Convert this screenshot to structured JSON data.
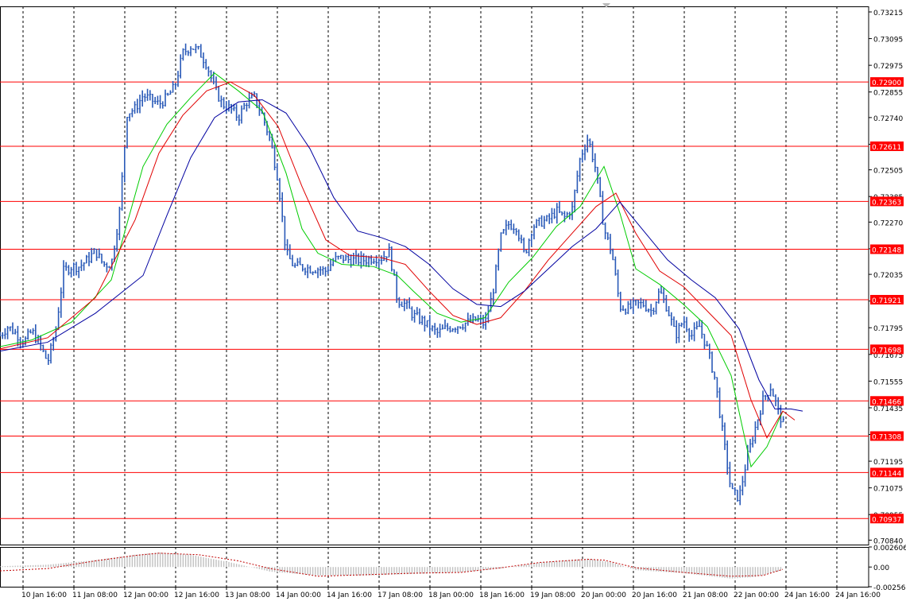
{
  "chart_data": [
    {
      "type": "candlestick",
      "y_ticks": [
        "0.73215",
        "0.73095",
        "0.72975",
        "0.72855",
        "0.72740",
        "0.72620",
        "0.72505",
        "0.72385",
        "0.72270",
        "0.72150",
        "0.72035",
        "0.71915",
        "0.71795",
        "0.71675",
        "0.71555",
        "0.71435",
        "0.71315",
        "0.71195",
        "0.71075",
        "0.70955",
        "0.70840"
      ],
      "ylim": [
        0.7082,
        0.7324
      ],
      "x_ticks": [
        "10 Jan 16:00",
        "11 Jan 08:00",
        "12 Jan 00:00",
        "12 Jan 16:00",
        "13 Jan 08:00",
        "14 Jan 00:00",
        "14 Jan 16:00",
        "17 Jan 08:00",
        "18 Jan 00:00",
        "18 Jan 16:00",
        "19 Jan 08:00",
        "20 Jan 00:00",
        "20 Jan 16:00",
        "21 Jan 08:00",
        "22 Jan 00:00",
        "24 Jan 16:00",
        "24 Jan 16:00"
      ],
      "price_levels": [
        {
          "value": 0.729,
          "label": "0.72900"
        },
        {
          "value": 0.72611,
          "label": "0.72611"
        },
        {
          "value": 0.72363,
          "label": "0.72363"
        },
        {
          "value": 0.72148,
          "label": "0.72148"
        },
        {
          "value": 0.71921,
          "label": "0.71921"
        },
        {
          "value": 0.71698,
          "label": "0.71698"
        },
        {
          "value": 0.71466,
          "label": "0.71466"
        },
        {
          "value": 0.71308,
          "label": "0.71308"
        },
        {
          "value": 0.71144,
          "label": "0.71144"
        },
        {
          "value": 0.70937,
          "label": "0.70937"
        }
      ],
      "price_path": [
        [
          0,
          0.7176
        ],
        [
          10,
          0.718
        ],
        [
          20,
          0.7177
        ],
        [
          30,
          0.7173
        ],
        [
          40,
          0.7178
        ],
        [
          50,
          0.7172
        ],
        [
          60,
          0.7164
        ],
        [
          70,
          0.7178
        ],
        [
          80,
          0.7205
        ],
        [
          90,
          0.7207
        ],
        [
          100,
          0.7207
        ],
        [
          110,
          0.721
        ],
        [
          120,
          0.7214
        ],
        [
          130,
          0.7208
        ],
        [
          140,
          0.7208
        ],
        [
          150,
          0.723
        ],
        [
          160,
          0.7276
        ],
        [
          170,
          0.7278
        ],
        [
          180,
          0.7284
        ],
        [
          190,
          0.7282
        ],
        [
          200,
          0.728
        ],
        [
          210,
          0.7283
        ],
        [
          220,
          0.7288
        ],
        [
          230,
          0.7303
        ],
        [
          240,
          0.7306
        ],
        [
          250,
          0.7304
        ],
        [
          260,
          0.7298
        ],
        [
          270,
          0.7287
        ],
        [
          280,
          0.728
        ],
        [
          290,
          0.7278
        ],
        [
          300,
          0.7274
        ],
        [
          310,
          0.7281
        ],
        [
          320,
          0.7283
        ],
        [
          330,
          0.7275
        ],
        [
          340,
          0.7264
        ],
        [
          350,
          0.7246
        ],
        [
          360,
          0.7213
        ],
        [
          370,
          0.7207
        ],
        [
          380,
          0.7207
        ],
        [
          390,
          0.7206
        ],
        [
          400,
          0.7206
        ],
        [
          410,
          0.7205
        ],
        [
          420,
          0.721
        ],
        [
          430,
          0.7211
        ],
        [
          440,
          0.721
        ],
        [
          450,
          0.721
        ],
        [
          460,
          0.721
        ],
        [
          470,
          0.7211
        ],
        [
          480,
          0.7211
        ],
        [
          490,
          0.7214
        ],
        [
          500,
          0.7192
        ],
        [
          510,
          0.719
        ],
        [
          520,
          0.7185
        ],
        [
          530,
          0.7183
        ],
        [
          540,
          0.718
        ],
        [
          550,
          0.7177
        ],
        [
          560,
          0.7179
        ],
        [
          570,
          0.718
        ],
        [
          580,
          0.7181
        ],
        [
          590,
          0.7182
        ],
        [
          600,
          0.7183
        ],
        [
          610,
          0.7181
        ],
        [
          620,
          0.7195
        ],
        [
          630,
          0.722
        ],
        [
          640,
          0.7226
        ],
        [
          650,
          0.7225
        ],
        [
          660,
          0.7212
        ],
        [
          670,
          0.7225
        ],
        [
          680,
          0.7227
        ],
        [
          690,
          0.7228
        ],
        [
          700,
          0.7232
        ],
        [
          710,
          0.7229
        ],
        [
          720,
          0.7233
        ],
        [
          730,
          0.7256
        ],
        [
          740,
          0.7265
        ],
        [
          750,
          0.725
        ],
        [
          760,
          0.7224
        ],
        [
          770,
          0.7213
        ],
        [
          780,
          0.7189
        ],
        [
          790,
          0.7188
        ],
        [
          800,
          0.719
        ],
        [
          810,
          0.719
        ],
        [
          820,
          0.7187
        ],
        [
          830,
          0.7196
        ],
        [
          840,
          0.7188
        ],
        [
          850,
          0.7176
        ],
        [
          860,
          0.7183
        ],
        [
          870,
          0.7176
        ],
        [
          880,
          0.718
        ],
        [
          890,
          0.717
        ],
        [
          900,
          0.7156
        ],
        [
          910,
          0.713
        ],
        [
          920,
          0.7106
        ],
        [
          930,
          0.7103
        ],
        [
          940,
          0.7121
        ],
        [
          950,
          0.7134
        ],
        [
          960,
          0.7147
        ],
        [
          970,
          0.7153
        ],
        [
          980,
          0.7141
        ],
        [
          987,
          0.7135
        ]
      ],
      "moving_averages": [
        {
          "color": "#00cc00",
          "points": [
            [
              0,
              0.7171
            ],
            [
              40,
              0.7174
            ],
            [
              90,
              0.7182
            ],
            [
              140,
              0.7201
            ],
            [
              180,
              0.7252
            ],
            [
              210,
              0.7271
            ],
            [
              240,
              0.7283
            ],
            [
              270,
              0.7294
            ],
            [
              300,
              0.7286
            ],
            [
              330,
              0.7277
            ],
            [
              360,
              0.7249
            ],
            [
              380,
              0.7224
            ],
            [
              400,
              0.7213
            ],
            [
              430,
              0.7208
            ],
            [
              470,
              0.7207
            ],
            [
              500,
              0.7203
            ],
            [
              520,
              0.7196
            ],
            [
              550,
              0.7186
            ],
            [
              580,
              0.7182
            ],
            [
              610,
              0.7184
            ],
            [
              640,
              0.72
            ],
            [
              670,
              0.7211
            ],
            [
              700,
              0.7225
            ],
            [
              730,
              0.7234
            ],
            [
              760,
              0.7252
            ],
            [
              780,
              0.7231
            ],
            [
              800,
              0.7206
            ],
            [
              830,
              0.7199
            ],
            [
              860,
              0.719
            ],
            [
              890,
              0.718
            ],
            [
              920,
              0.7158
            ],
            [
              945,
              0.7117
            ],
            [
              965,
              0.7126
            ],
            [
              985,
              0.7142
            ]
          ]
        },
        {
          "color": "#e00000",
          "points": [
            [
              0,
              0.717
            ],
            [
              60,
              0.7175
            ],
            [
              120,
              0.7193
            ],
            [
              170,
              0.7228
            ],
            [
              200,
              0.7258
            ],
            [
              230,
              0.7275
            ],
            [
              260,
              0.7286
            ],
            [
              290,
              0.729
            ],
            [
              320,
              0.7284
            ],
            [
              350,
              0.727
            ],
            [
              380,
              0.7243
            ],
            [
              410,
              0.7219
            ],
            [
              440,
              0.7212
            ],
            [
              480,
              0.7211
            ],
            [
              510,
              0.7208
            ],
            [
              540,
              0.7196
            ],
            [
              570,
              0.7185
            ],
            [
              600,
              0.7181
            ],
            [
              630,
              0.7184
            ],
            [
              660,
              0.7196
            ],
            [
              690,
              0.721
            ],
            [
              720,
              0.7222
            ],
            [
              750,
              0.7234
            ],
            [
              775,
              0.724
            ],
            [
              800,
              0.7222
            ],
            [
              830,
              0.7205
            ],
            [
              860,
              0.7198
            ],
            [
              890,
              0.7187
            ],
            [
              920,
              0.7176
            ],
            [
              945,
              0.7147
            ],
            [
              965,
              0.713
            ],
            [
              985,
              0.7142
            ],
            [
              1000,
              0.7138
            ]
          ]
        },
        {
          "color": "#0000a0",
          "points": [
            [
              0,
              0.7169
            ],
            [
              60,
              0.7173
            ],
            [
              120,
              0.7186
            ],
            [
              180,
              0.7203
            ],
            [
              210,
              0.723
            ],
            [
              240,
              0.7256
            ],
            [
              270,
              0.7274
            ],
            [
              300,
              0.7281
            ],
            [
              330,
              0.7282
            ],
            [
              360,
              0.7276
            ],
            [
              390,
              0.726
            ],
            [
              420,
              0.7238
            ],
            [
              450,
              0.7223
            ],
            [
              480,
              0.722
            ],
            [
              510,
              0.7216
            ],
            [
              540,
              0.7208
            ],
            [
              570,
              0.7197
            ],
            [
              600,
              0.719
            ],
            [
              630,
              0.7189
            ],
            [
              660,
              0.7196
            ],
            [
              690,
              0.7206
            ],
            [
              720,
              0.7216
            ],
            [
              750,
              0.7224
            ],
            [
              780,
              0.7236
            ],
            [
              810,
              0.7223
            ],
            [
              840,
              0.721
            ],
            [
              870,
              0.7201
            ],
            [
              900,
              0.7193
            ],
            [
              930,
              0.7179
            ],
            [
              955,
              0.7156
            ],
            [
              975,
              0.7143
            ],
            [
              995,
              0.7143
            ],
            [
              1010,
              0.7142
            ]
          ]
        }
      ]
    },
    {
      "type": "histogram",
      "y_ticks": [
        "0.002606",
        "0.00",
        "-0.00256"
      ],
      "ylim": [
        -0.00256,
        0.002606
      ],
      "signal_color": "#c00000",
      "histogram_color": "#c0c0c0",
      "signal_path": [
        [
          0,
          -0.0005
        ],
        [
          60,
          -0.0002
        ],
        [
          120,
          0.0008
        ],
        [
          170,
          0.0015
        ],
        [
          200,
          0.0018
        ],
        [
          250,
          0.0016
        ],
        [
          300,
          0.0008
        ],
        [
          340,
          -0.0002
        ],
        [
          400,
          -0.0012
        ],
        [
          460,
          -0.001
        ],
        [
          520,
          -0.0008
        ],
        [
          580,
          -0.0007
        ],
        [
          630,
          -0.0001
        ],
        [
          680,
          0.0006
        ],
        [
          740,
          0.001
        ],
        [
          760,
          0.0009
        ],
        [
          800,
          -0.0001
        ],
        [
          860,
          -0.0007
        ],
        [
          920,
          -0.0012
        ],
        [
          960,
          -0.0011
        ],
        [
          985,
          -0.0003
        ]
      ],
      "histogram_path": [
        [
          0,
          0.0001
        ],
        [
          60,
          0.0003
        ],
        [
          120,
          0.0009
        ],
        [
          170,
          0.0016
        ],
        [
          200,
          0.0019
        ],
        [
          240,
          0.0016
        ],
        [
          290,
          0.0006
        ],
        [
          340,
          -0.0006
        ],
        [
          400,
          -0.0011
        ],
        [
          460,
          -0.0011
        ],
        [
          520,
          -0.0009
        ],
        [
          580,
          -0.0007
        ],
        [
          630,
          -0.0002
        ],
        [
          680,
          0.0006
        ],
        [
          740,
          0.0011
        ],
        [
          770,
          0.0006
        ],
        [
          800,
          -0.0004
        ],
        [
          860,
          -0.0008
        ],
        [
          920,
          -0.0015
        ],
        [
          950,
          -0.0013
        ],
        [
          985,
          -0.0004
        ]
      ]
    }
  ]
}
